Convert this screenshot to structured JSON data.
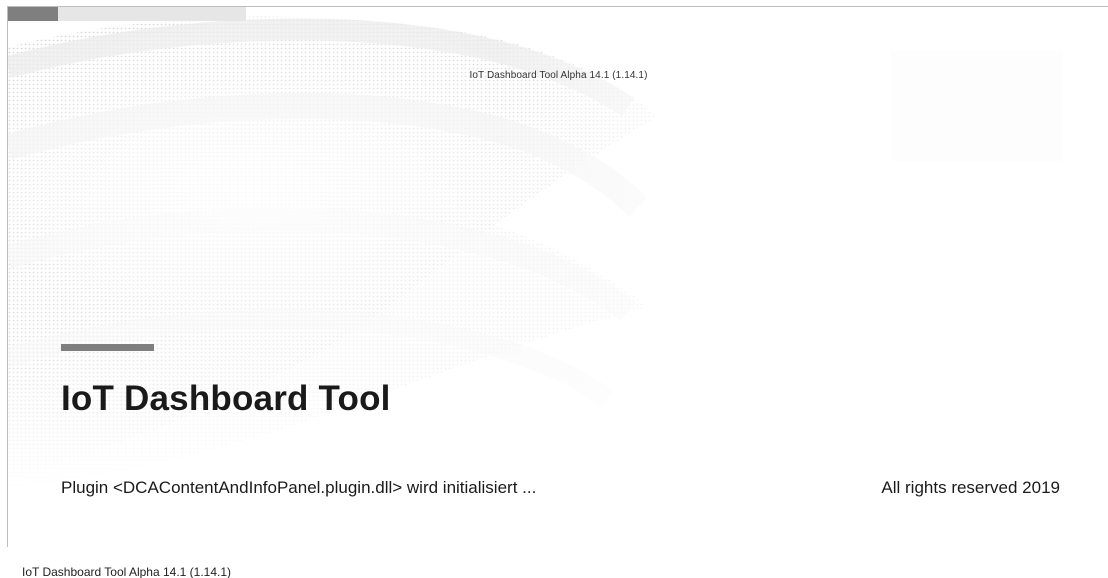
{
  "splash": {
    "version_label": "IoT Dashboard Tool Alpha 14.1 (1.14.1)",
    "progress": 0.21,
    "title": "IoT Dashboard Tool",
    "status": "Plugin <DCAContentAndInfoPanel.plugin.dll> wird initialisiert ...",
    "copyright": "All rights reserved 2019",
    "accent_color": "#7f7f7f"
  },
  "window_caption": {
    "title": "IoT Dashboard Tool Alpha 14.1 (1.14.1)"
  }
}
